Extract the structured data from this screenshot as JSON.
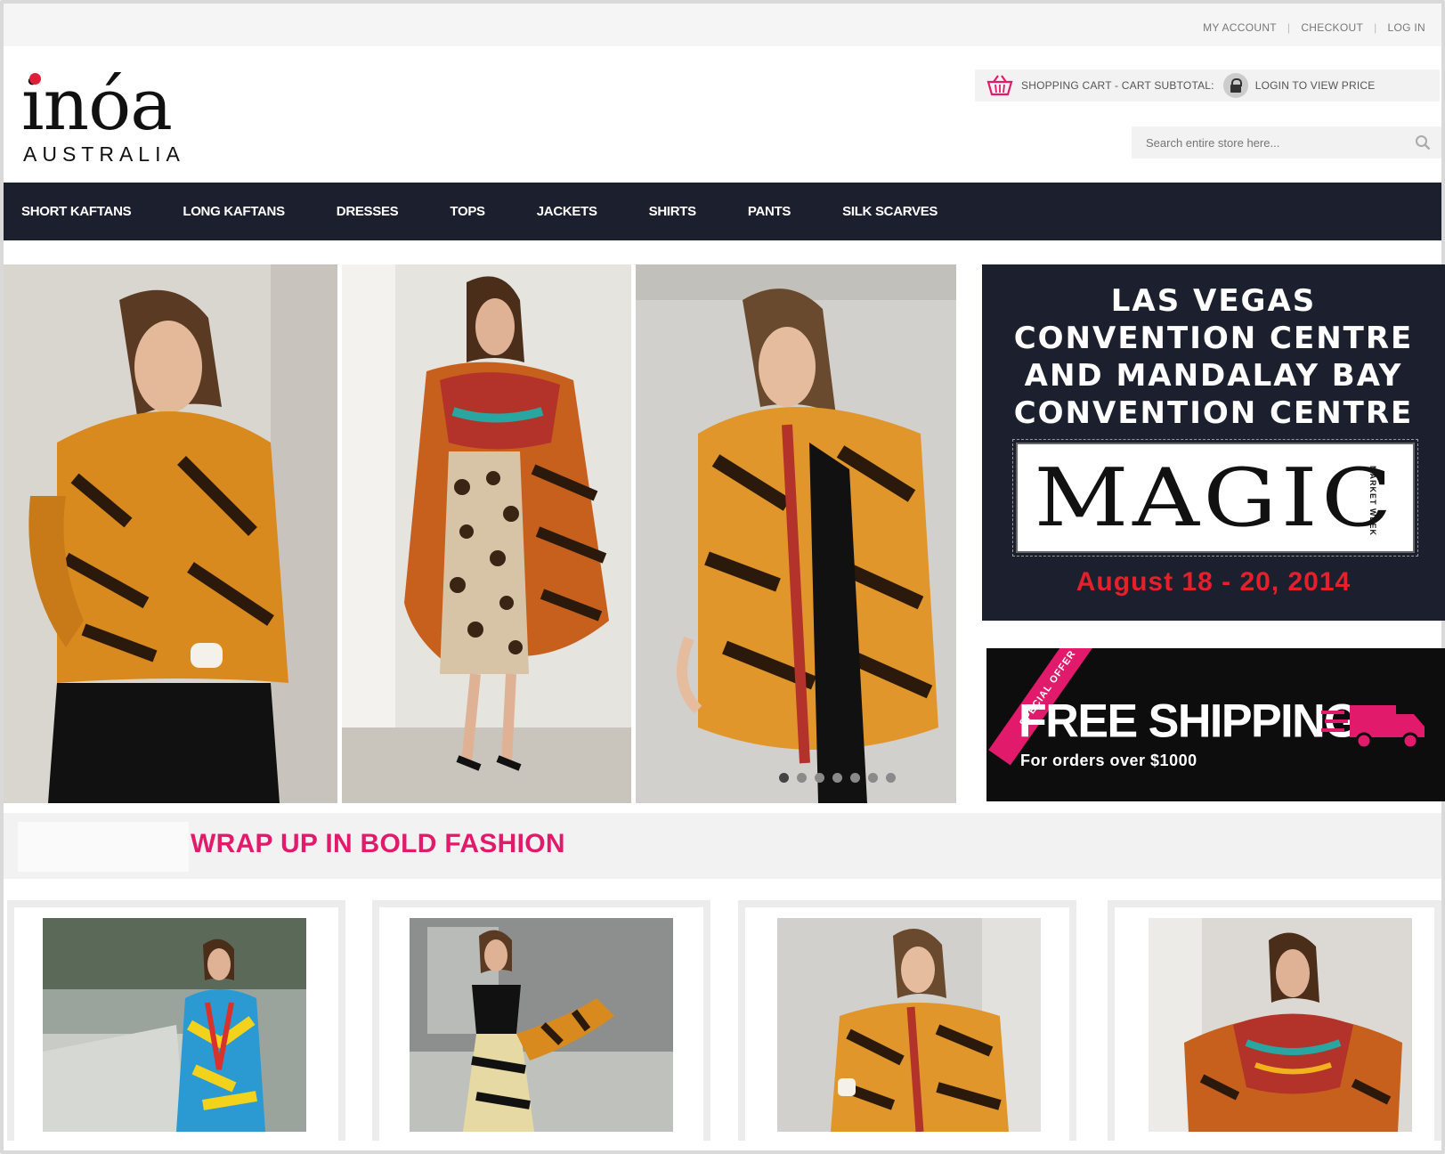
{
  "top_links": [
    "MY ACCOUNT",
    "CHECKOUT",
    "LOG IN"
  ],
  "logo": {
    "main": "inóa",
    "sub": "AUSTRALIA"
  },
  "cart": {
    "label": "SHOPPING CART - CART SUBTOTAL:",
    "login_text": "LOGIN TO VIEW PRICE"
  },
  "search": {
    "placeholder": "Search entire store here..."
  },
  "nav": [
    "SHORT KAFTANS",
    "LONG KAFTANS",
    "DRESSES",
    "TOPS",
    "JACKETS",
    "SHIRTS",
    "PANTS",
    "SILK SCARVES"
  ],
  "event": {
    "lines": [
      "LAS VEGAS",
      "CONVENTION CENTRE",
      "AND MANDALAY BAY",
      "CONVENTION CENTRE"
    ],
    "logo_text": "MAGIC",
    "logo_sub": "MARKET WEEK",
    "date": "August 18 - 20, 2014"
  },
  "shipping": {
    "ribbon": "SPECIAL OFFER",
    "title": "FREE SHIPPING",
    "subtitle": "For orders over $1000"
  },
  "section_title": "WRAP UP IN BOLD FASHION",
  "slider": {
    "slide_count": 7,
    "active_index": 0
  },
  "colors": {
    "nav_bg": "#1c1f2e",
    "accent_pink": "#e21a6b",
    "date_red": "#e4202b"
  },
  "icons": [
    "cart-icon",
    "lock-icon",
    "search-icon",
    "truck-icon"
  ]
}
